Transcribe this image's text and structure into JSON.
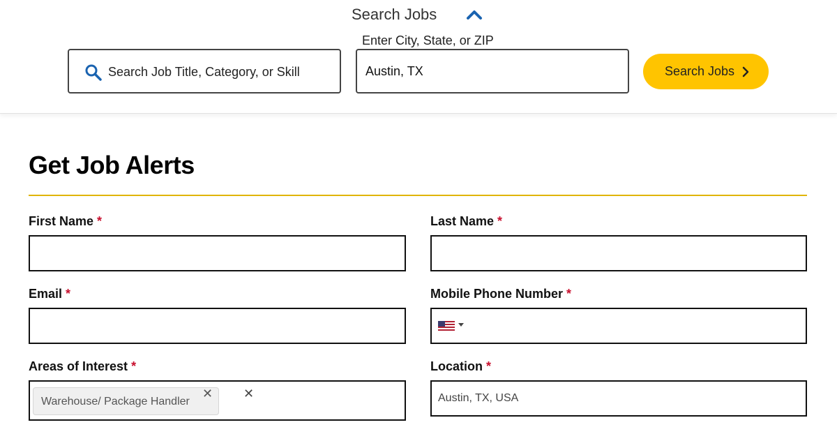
{
  "search_bar": {
    "title": "Search Jobs",
    "keyword_placeholder": "Search Job Title, Category, or Skill",
    "location_label": "Enter City, State, or ZIP",
    "location_value": "Austin, TX",
    "search_button_label": "Search Jobs",
    "colors": {
      "button": "#ffc400",
      "chevron": "#1a63b0",
      "search_icon": "#1a63b0"
    }
  },
  "form": {
    "title": "Get Job Alerts",
    "accent_color": "#e0b400",
    "required_marker": "*",
    "first_name_label": "First Name",
    "last_name_label": "Last Name",
    "email_label": "Email",
    "phone_label": "Mobile Phone Number",
    "phone_country_icon": "us-flag-icon",
    "areas_label": "Areas of Interest",
    "areas_selected": [
      "Warehouse/ Package Handler"
    ],
    "location_label": "Location",
    "location_value": "Austin, TX, USA",
    "tag_remove_glyph": "✕",
    "clear_glyph": "✕"
  }
}
